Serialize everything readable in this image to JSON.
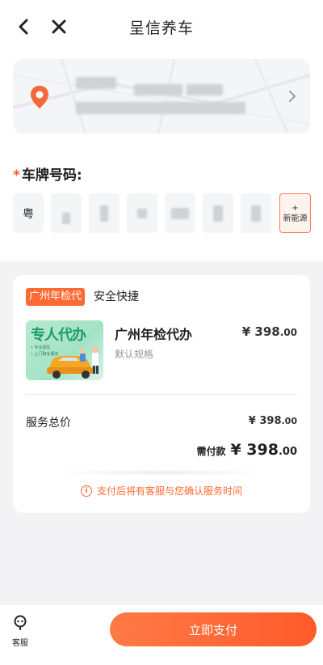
{
  "header": {
    "title": "呈信养车",
    "back_icon": "chevron-left-icon",
    "close_icon": "close-icon"
  },
  "address": {
    "icon": "location-pin-icon",
    "accent": "#f5683a"
  },
  "plate": {
    "label": "车牌号码:",
    "required_mark": "*",
    "province": "粤",
    "new_energy_plus": "+",
    "new_energy_label": "新能源"
  },
  "order": {
    "tag": "广州年检代",
    "tag_desc": "安全快捷",
    "product": {
      "image_title": "专人代办",
      "image_lines": [
        "• 专业团队",
        "• 上门取车服务"
      ],
      "name": "广州年检代办",
      "spec": "默认规格",
      "price_int": "¥ 398",
      "price_dec": ".00"
    },
    "total_label": "服务总价",
    "total_int": "¥ 398",
    "total_dec": ".00",
    "need_pay_label": "需付款",
    "need_pay_int": "¥ 398",
    "need_pay_dec": ".00",
    "notice_icon": "i",
    "notice": "支付后将有客服与您确认服务时间"
  },
  "bottom": {
    "service_icon": "customer-service-icon",
    "service_label": "客服",
    "pay_button": "立即支付"
  },
  "colors": {
    "brand_orange": "#ff6a33",
    "page_bg": "#f3f3f5"
  }
}
